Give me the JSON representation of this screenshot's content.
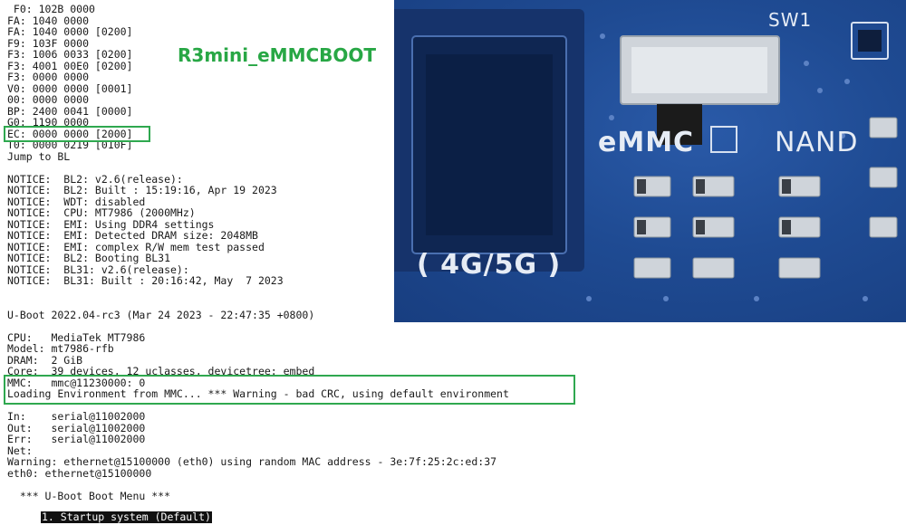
{
  "overlay_title": "R3mini_eMMCBOOT",
  "terminal_lines": [
    " F0: 102B 0000",
    "FA: 1040 0000",
    "FA: 1040 0000 [0200]",
    "F9: 103F 0000",
    "F3: 1006 0033 [0200]",
    "F3: 4001 00E0 [0200]",
    "F3: 0000 0000",
    "V0: 0000 0000 [0001]",
    "00: 0000 0000",
    "BP: 2400 0041 [0000]",
    "G0: 1190 0000",
    "EC: 0000 0000 [2000]",
    "T0: 0000 0219 [010F]",
    "Jump to BL",
    "",
    "NOTICE:  BL2: v2.6(release):",
    "NOTICE:  BL2: Built : 15:19:16, Apr 19 2023",
    "NOTICE:  WDT: disabled",
    "NOTICE:  CPU: MT7986 (2000MHz)",
    "NOTICE:  EMI: Using DDR4 settings",
    "NOTICE:  EMI: Detected DRAM size: 2048MB",
    "NOTICE:  EMI: complex R/W mem test passed",
    "NOTICE:  BL2: Booting BL31",
    "NOTICE:  BL31: v2.6(release):",
    "NOTICE:  BL31: Built : 20:16:42, May  7 2023",
    "",
    "",
    "U-Boot 2022.04-rc3 (Mar 24 2023 - 22:47:35 +0800)",
    "",
    "CPU:   MediaTek MT7986",
    "Model: mt7986-rfb",
    "DRAM:  2 GiB",
    "Core:  39 devices, 12 uclasses, devicetree: embed",
    "MMC:   mmc@11230000: 0",
    "Loading Environment from MMC... *** Warning - bad CRC, using default environment",
    "",
    "In:    serial@11002000",
    "Out:   serial@11002000",
    "Err:   serial@11002000",
    "Net:",
    "Warning: ethernet@15100000 (eth0) using random MAC address - 3e:7f:25:2c:ed:37",
    "eth0: ethernet@15100000",
    "",
    "  *** U-Boot Boot Menu ***",
    ""
  ],
  "menu_selected": "1. Startup system (Default)",
  "board": {
    "switch_label": "SW1",
    "emmc_label": "eMMC",
    "nand_label": "NAND",
    "band_label": "( 4G/5G )"
  },
  "colors": {
    "highlight": "#2fa84f",
    "title": "#28a745",
    "board_blue": "#1f4b93"
  }
}
